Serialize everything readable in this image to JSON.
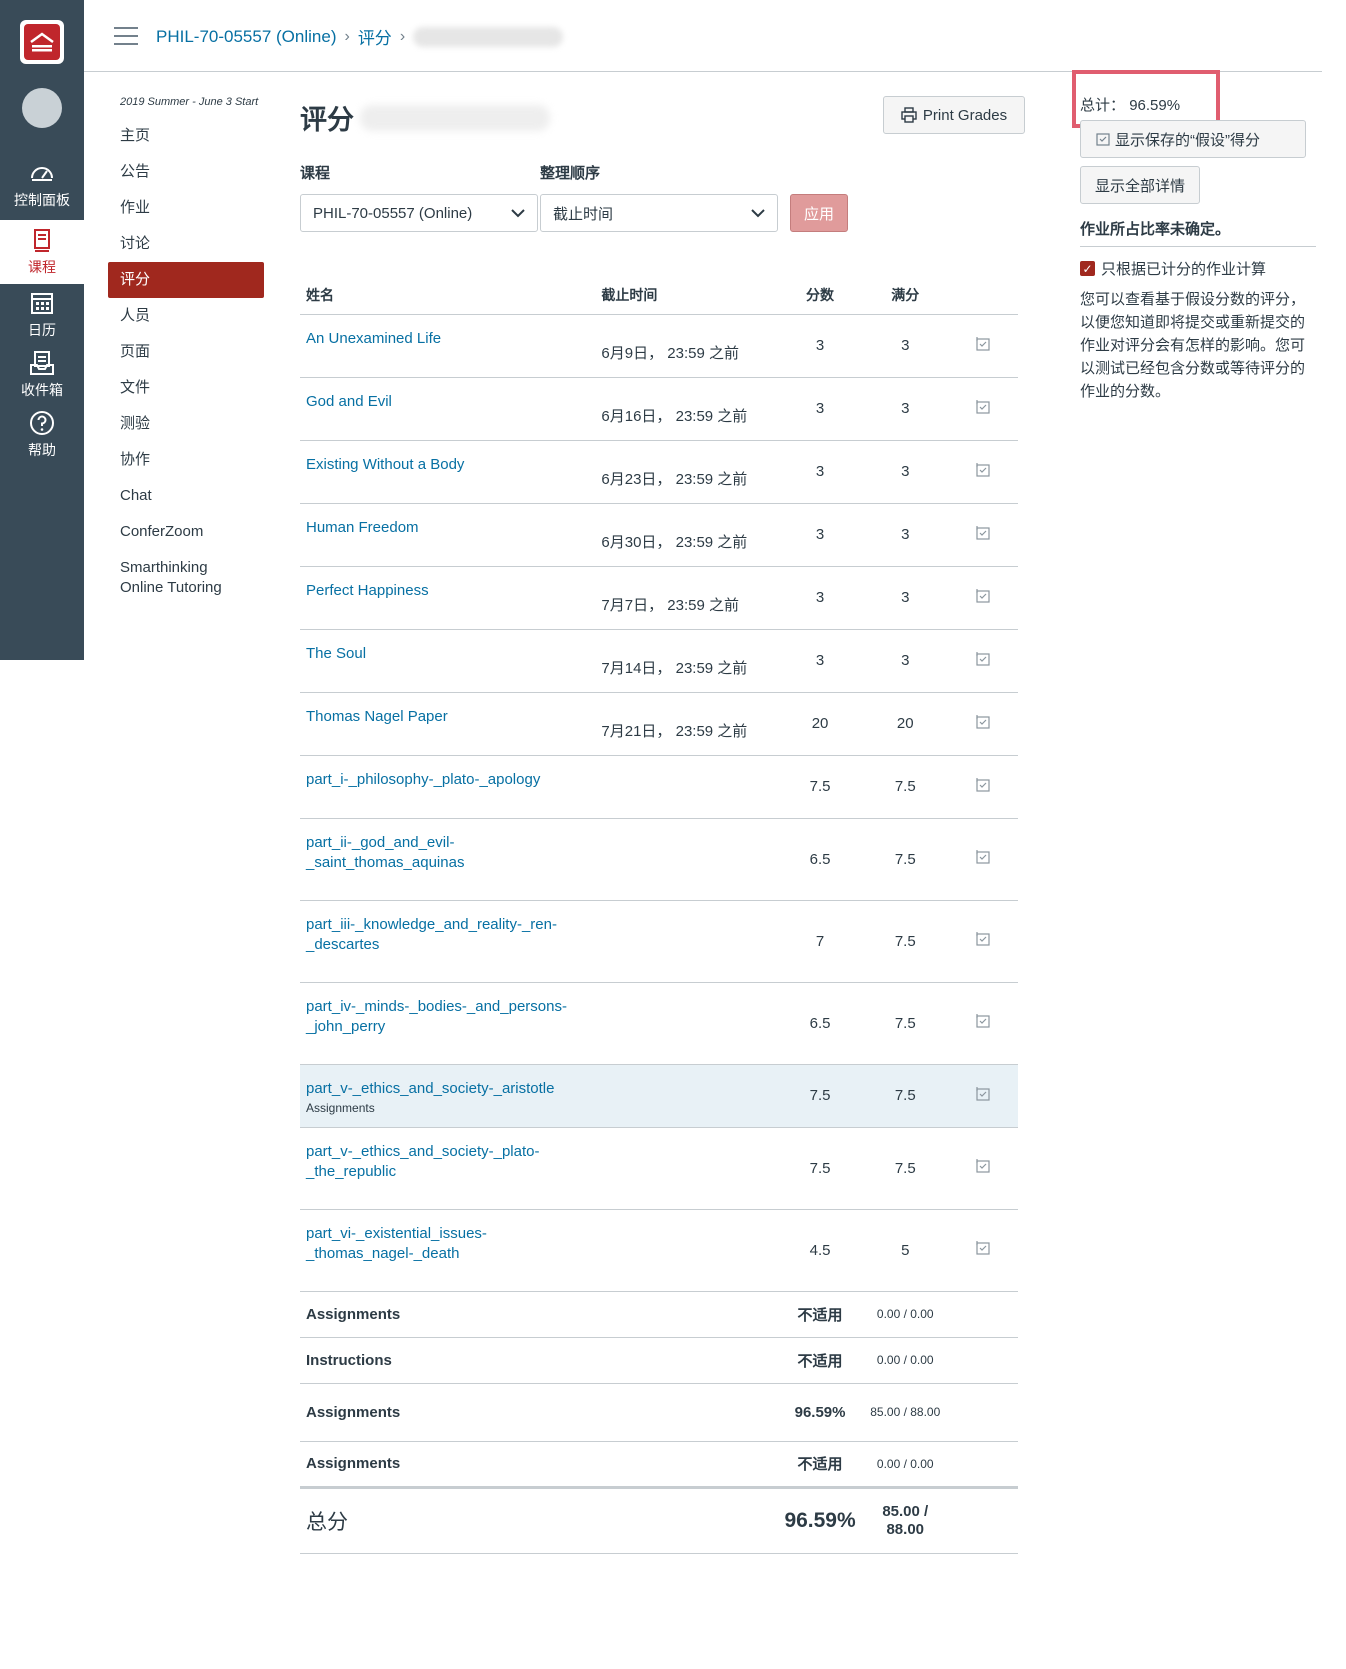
{
  "global_nav": {
    "items": [
      {
        "label": "控制面板"
      },
      {
        "label": "课程"
      },
      {
        "label": "日历"
      },
      {
        "label": "收件箱"
      },
      {
        "label": "帮助"
      }
    ]
  },
  "breadcrumb": {
    "course": "PHIL-70-05557 (Online)",
    "section": "评分"
  },
  "course_nav": {
    "term": "2019 Summer - June 3 Start",
    "items": [
      {
        "label": "主页"
      },
      {
        "label": "公告"
      },
      {
        "label": "作业"
      },
      {
        "label": "讨论"
      },
      {
        "label": "评分"
      },
      {
        "label": "人员"
      },
      {
        "label": "页面"
      },
      {
        "label": "文件"
      },
      {
        "label": "测验"
      },
      {
        "label": "协作"
      },
      {
        "label": "Chat"
      },
      {
        "label": "ConferZoom"
      },
      {
        "label": "Smarthinking Online Tutoring"
      }
    ]
  },
  "main": {
    "title": "评分",
    "print_button": "Print Grades",
    "course_label": "课程",
    "course_value": "PHIL-70-05557 (Online)",
    "sort_label": "整理顺序",
    "sort_value": "截止时间",
    "apply_button": "应用"
  },
  "table": {
    "headers": {
      "name": "姓名",
      "due": "截止时间",
      "score": "分数",
      "out_of": "满分"
    },
    "rows": [
      {
        "name": "An Unexamined Life",
        "due": "6月9日， 23:59 之前",
        "score": "3",
        "out_of": "3"
      },
      {
        "name": "God and Evil",
        "due": "6月16日， 23:59 之前",
        "score": "3",
        "out_of": "3"
      },
      {
        "name": "Existing Without a Body",
        "due": "6月23日， 23:59 之前",
        "score": "3",
        "out_of": "3"
      },
      {
        "name": "Human Freedom",
        "due": "6月30日， 23:59 之前",
        "score": "3",
        "out_of": "3"
      },
      {
        "name": "Perfect Happiness",
        "due": "7月7日， 23:59 之前",
        "score": "3",
        "out_of": "3"
      },
      {
        "name": "The Soul",
        "due": "7月14日， 23:59 之前",
        "score": "3",
        "out_of": "3"
      },
      {
        "name": "Thomas Nagel Paper",
        "due": "7月21日， 23:59 之前",
        "score": "20",
        "out_of": "20"
      },
      {
        "name": "part_i-_philosophy-_plato-_apology",
        "due": "",
        "score": "7.5",
        "out_of": "7.5"
      },
      {
        "name": "part_ii-_god_and_evil-_saint_thomas_aquinas",
        "due": "",
        "score": "6.5",
        "out_of": "7.5"
      },
      {
        "name": "part_iii-_knowledge_and_reality-_ren-_descartes",
        "due": "",
        "score": "7",
        "out_of": "7.5"
      },
      {
        "name": "part_iv-_minds-_bodies-_and_persons-_john_perry",
        "due": "",
        "score": "6.5",
        "out_of": "7.5"
      },
      {
        "name": "part_v-_ethics_and_society-_aristotle",
        "sub": "Assignments",
        "due": "",
        "score": "7.5",
        "out_of": "7.5"
      },
      {
        "name": "part_v-_ethics_and_society-_plato-_the_republic",
        "due": "",
        "score": "7.5",
        "out_of": "7.5"
      },
      {
        "name": "part_vi-_existential_issues-_thomas_nagel-_death",
        "due": "",
        "score": "4.5",
        "out_of": "5"
      }
    ],
    "groups": [
      {
        "name": "Assignments",
        "pct": "不适用",
        "pts": "0.00 / 0.00"
      },
      {
        "name": "Instructions",
        "pct": "不适用",
        "pts": "0.00 / 0.00"
      },
      {
        "name": "Assignments",
        "pct": "96.59%",
        "pts": "85.00 / 88.00"
      },
      {
        "name": "Assignments",
        "pct": "不适用",
        "pts": "0.00 / 0.00"
      }
    ],
    "total": {
      "label": "总分",
      "pct": "96.59%",
      "pts": "85.00 / 88.00"
    }
  },
  "sidebar": {
    "total_label": "总计：",
    "total_value": "96.59%",
    "show_saved_button": "显示保存的“假设”得分",
    "show_details_button": "显示全部详情",
    "weight_note": "作业所占比率未确定。",
    "checkbox_label": "只根据已计分的作业计算",
    "help_text": "您可以查看基于假设分数的评分，以便您知道即将提交或重新提交的作业对评分会有怎样的影响。您可以测试已经包含分数或等待评分的作业的分数。"
  },
  "colors": {
    "nav_bg": "#394b58",
    "link": "#0770a3",
    "accent": "#a0281e",
    "highlight_box": "#e05d6f"
  }
}
